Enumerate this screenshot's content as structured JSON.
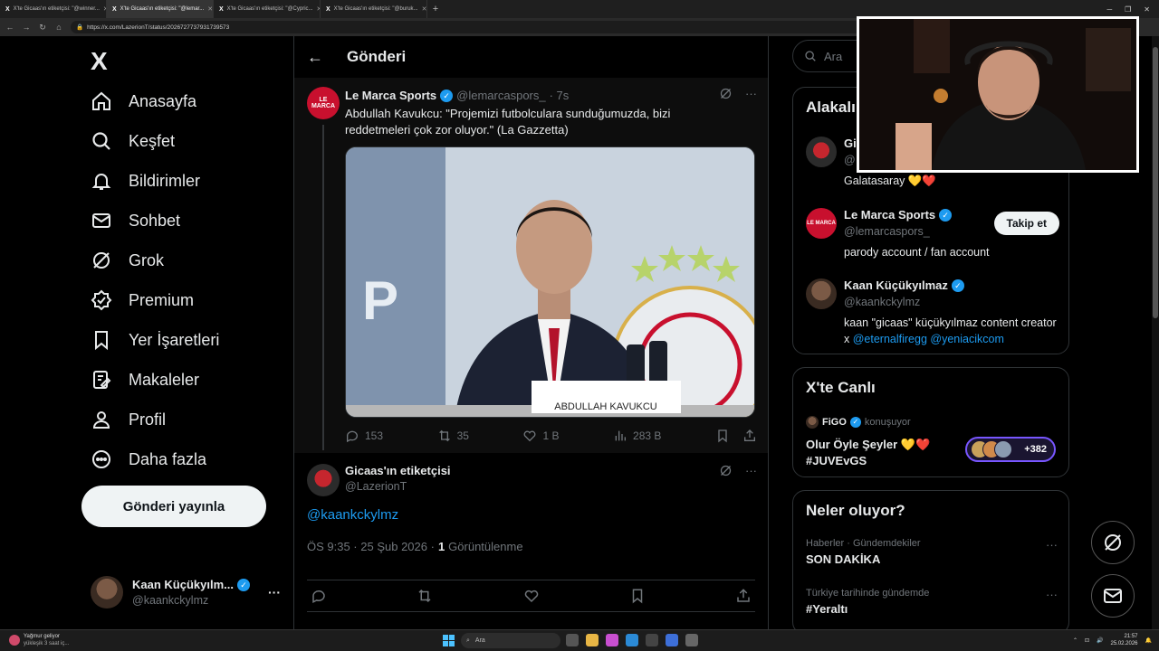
{
  "browser": {
    "tabs": [
      {
        "label": "X'te Gicaas'ın etiketçisi: \"@winner...",
        "active": false
      },
      {
        "label": "X'te Gicaas'ın etiketçisi: \"@lemar...",
        "active": true
      },
      {
        "label": "X'te Gicaas'ın etiketçisi: \"@Cypric...",
        "active": false
      },
      {
        "label": "X'te Gicaas'ın etiketçisi: \"@buruk...",
        "active": false
      }
    ],
    "url": "https://x.com/LazerionT/status/2026727737931739573"
  },
  "sidebar": {
    "logo": "X",
    "items": [
      {
        "label": "Anasayfa",
        "icon": "home-icon"
      },
      {
        "label": "Keşfet",
        "icon": "search-icon"
      },
      {
        "label": "Bildirimler",
        "icon": "bell-icon"
      },
      {
        "label": "Sohbet",
        "icon": "mail-icon"
      },
      {
        "label": "Grok",
        "icon": "grok-icon"
      },
      {
        "label": "Premium",
        "icon": "premium-icon"
      },
      {
        "label": "Yer İşaretleri",
        "icon": "bookmark-icon"
      },
      {
        "label": "Makaleler",
        "icon": "article-icon"
      },
      {
        "label": "Profil",
        "icon": "profile-icon"
      },
      {
        "label": "Daha fazla",
        "icon": "more-icon"
      }
    ],
    "post_button": "Gönderi yayınla",
    "account": {
      "name": "Kaan Küçükyılm...",
      "handle": "@kaankckylmz",
      "more": "···"
    }
  },
  "center": {
    "header": {
      "title": "Gönderi",
      "back": "←"
    },
    "quoted": {
      "avatar_text": "LE MARCA",
      "name": "Le Marca Sports",
      "handle": "@lemarcaspors_",
      "time": "· 7s",
      "text": "Abdullah Kavukcu: \"Projemizi futbolculara sunduğumuzda, bizi reddetmeleri çok zor oluyor.\" (La Gazzetta)",
      "nameplate": "ABDULLAH KAVUKCU",
      "stats": {
        "replies": "153",
        "reposts": "35",
        "likes": "1 B",
        "views": "283 B"
      }
    },
    "reply": {
      "name": "Gicaas'ın etiketçisi",
      "handle": "@LazerionT",
      "text": "@kaankckylmz",
      "time": "ÖS 9:35 · 25 Şub 2026 ·",
      "views_count": "1",
      "views_label": "Görüntülenme"
    }
  },
  "right": {
    "search_placeholder": "Ara",
    "related": {
      "title": "Alakalı",
      "people": [
        {
          "name": "Gi",
          "handle": "@",
          "bio": "Galatasaray 💛❤️"
        },
        {
          "name": "Le Marca Sports",
          "handle": "@lemarcaspors_",
          "bio": "parody account / fan account",
          "follow": "Takip et",
          "avatar_text": "LE MARCA"
        },
        {
          "name": "Kaan Küçükyılmaz",
          "handle": "@kaankckylmz",
          "bio_prefix": "kaan \"gicaas\" küçükyılmaz content creator x",
          "link1": "@eternalfiregg",
          "link2": "@yeniacikcom"
        }
      ]
    },
    "live": {
      "title": "X'te Canlı",
      "host": "FiGO",
      "host_status": "konuşuyor",
      "topic_line1": "Olur Öyle Şeyler 💛❤️",
      "topic_line2": "#JUVEvGS",
      "listeners": "+382"
    },
    "trends": {
      "title": "Neler oluyor?",
      "items": [
        {
          "category": "Haberler · Gündemdekiler",
          "title": "SON DAKİKA"
        },
        {
          "category": "Türkiye tarihinde gündemde",
          "title": "#Yeraltı"
        }
      ]
    }
  },
  "taskbar": {
    "weather_line1": "Yağmur geliyor",
    "weather_line2": "yükleşik 3 saat iç...",
    "search": "Ara",
    "time": "21:57",
    "date": "25.02.2026"
  },
  "colors": {
    "accent": "#1d9bf0",
    "bg": "#000000",
    "border": "#2f3336",
    "muted": "#71767b"
  }
}
